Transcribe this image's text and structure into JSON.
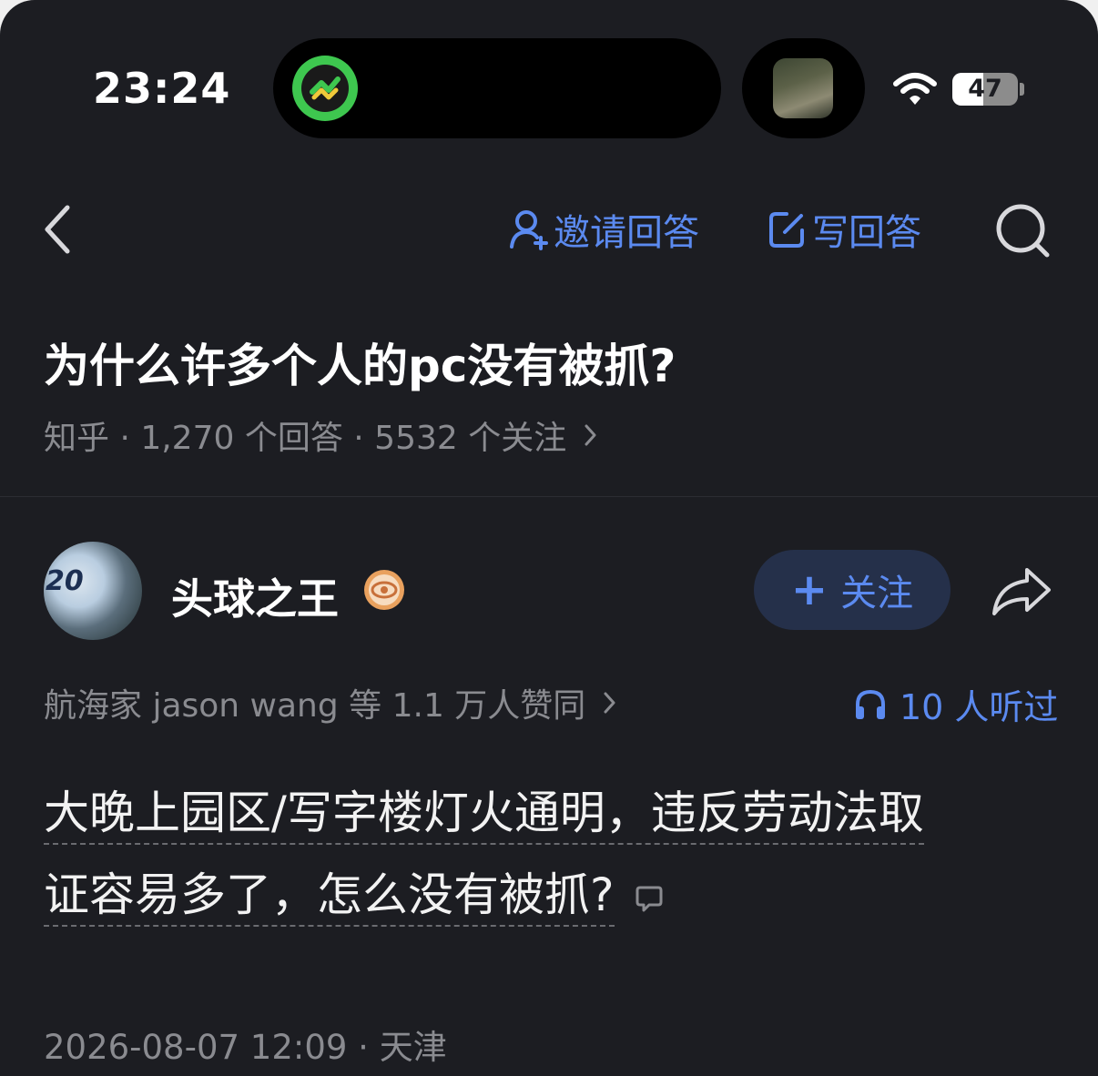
{
  "status_bar": {
    "time": "23:24",
    "battery": "47",
    "battery_level": 0.47
  },
  "nav": {
    "invite_label": "邀请回答",
    "write_label": "写回答"
  },
  "question": {
    "title": "为什么许多个人的pc没有被抓?",
    "meta": "知乎 · 1,270 个回答 · 5532 个关注"
  },
  "author": {
    "name": "头球之王",
    "avatar_jersey": "20",
    "follow_label": "关注"
  },
  "answer": {
    "upvote_text": "航海家 jason wang 等 1.1 万人赞同",
    "listened_text": "10 人听过",
    "line1": "大晚上园区/写字楼灯火通明，违反劳动法取",
    "line2": "证容易多了，怎么没有被抓?",
    "time_location": "2026-08-07 12:09 · 天津"
  },
  "colors": {
    "background": "#1c1d22",
    "accent": "#5b8af0",
    "secondary_text": "#8a8b90",
    "follow_bg": "#25304a"
  },
  "icons": [
    "back-chevron-icon",
    "person-add-icon",
    "edit-icon",
    "search-icon",
    "creator-badge-icon",
    "share-arrow-icon",
    "headphones-icon",
    "comment-icon",
    "wifi-icon",
    "app-activity-icon"
  ]
}
